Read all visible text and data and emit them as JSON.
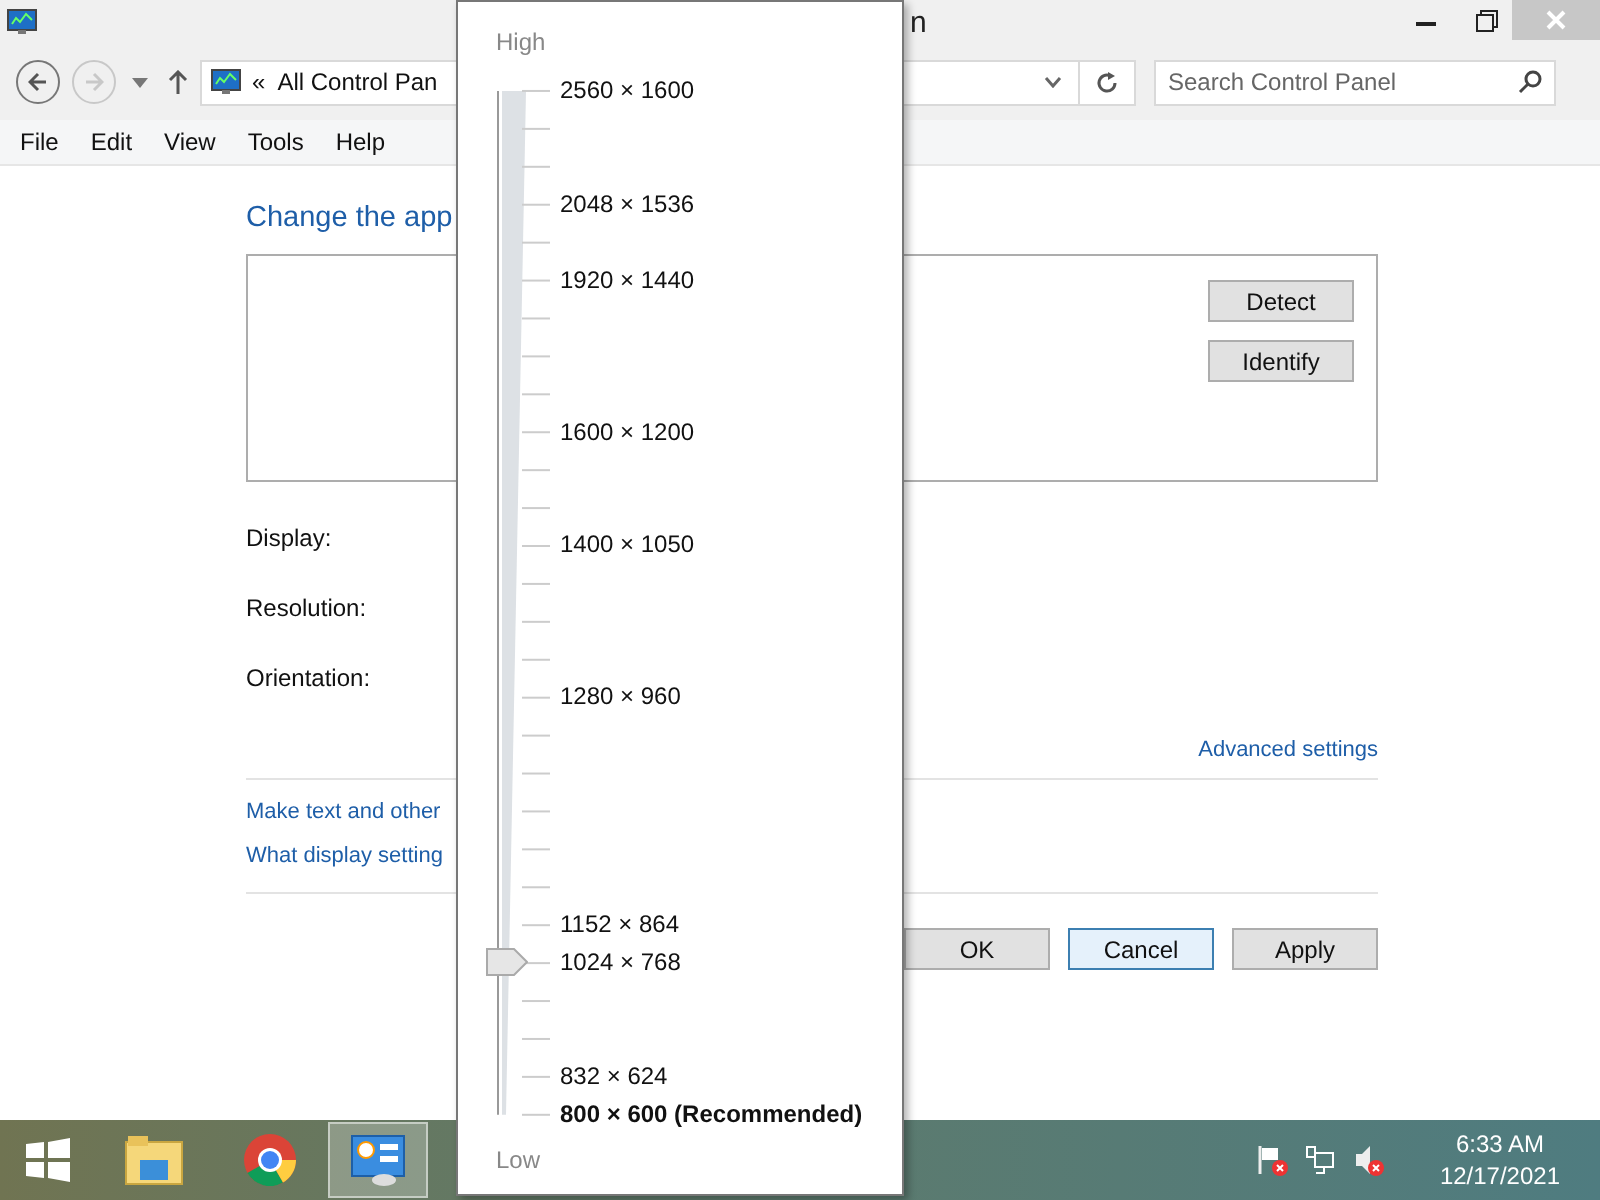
{
  "window": {
    "title": "n"
  },
  "toolbar": {
    "back_enabled": true,
    "forward_enabled": false,
    "address_prefix": "«",
    "address": "All Control Pan",
    "search": {
      "placeholder": "Search Control Panel"
    }
  },
  "menu": [
    "File",
    "Edit",
    "View",
    "Tools",
    "Help"
  ],
  "content": {
    "heading": "Change the app",
    "preview_buttons": [
      "Detect",
      "Identify"
    ],
    "fields": [
      "Display:",
      "Resolution:",
      "Orientation:"
    ],
    "advanced_link": "Advanced settings",
    "links": [
      "Make text and other",
      "What display setting"
    ],
    "dialog_buttons": [
      {
        "label": "OK",
        "focused": false
      },
      {
        "label": "Cancel",
        "focused": true
      },
      {
        "label": "Apply",
        "focused": false
      }
    ]
  },
  "resolution_popup": {
    "high_label": "High",
    "low_label": "Low",
    "level": 0.148,
    "options": [
      {
        "label": "2560 × 1600",
        "recommended": false
      },
      {
        "label": "2048 × 1536",
        "recommended": false
      },
      {
        "label": "1920 × 1440",
        "recommended": false
      },
      {
        "label": "1600 × 1200",
        "recommended": false
      },
      {
        "label": "1400 × 1050",
        "recommended": false
      },
      {
        "label": "1280 × 960",
        "recommended": false
      },
      {
        "label": "1152 × 864",
        "recommended": false
      },
      {
        "label": "1024 × 768",
        "recommended": false
      },
      {
        "label": "832 × 624",
        "recommended": false
      },
      {
        "label": "800 × 600 (Recommended)",
        "recommended": true
      }
    ]
  },
  "taskbar": {
    "apps": [
      {
        "kind": "start",
        "active": false
      },
      {
        "kind": "explorer",
        "active": false
      },
      {
        "kind": "chrome",
        "active": false
      },
      {
        "kind": "control-panel",
        "active": true
      }
    ]
  },
  "tray": {
    "time": "6:33 AM",
    "date": "12/17/2021"
  }
}
